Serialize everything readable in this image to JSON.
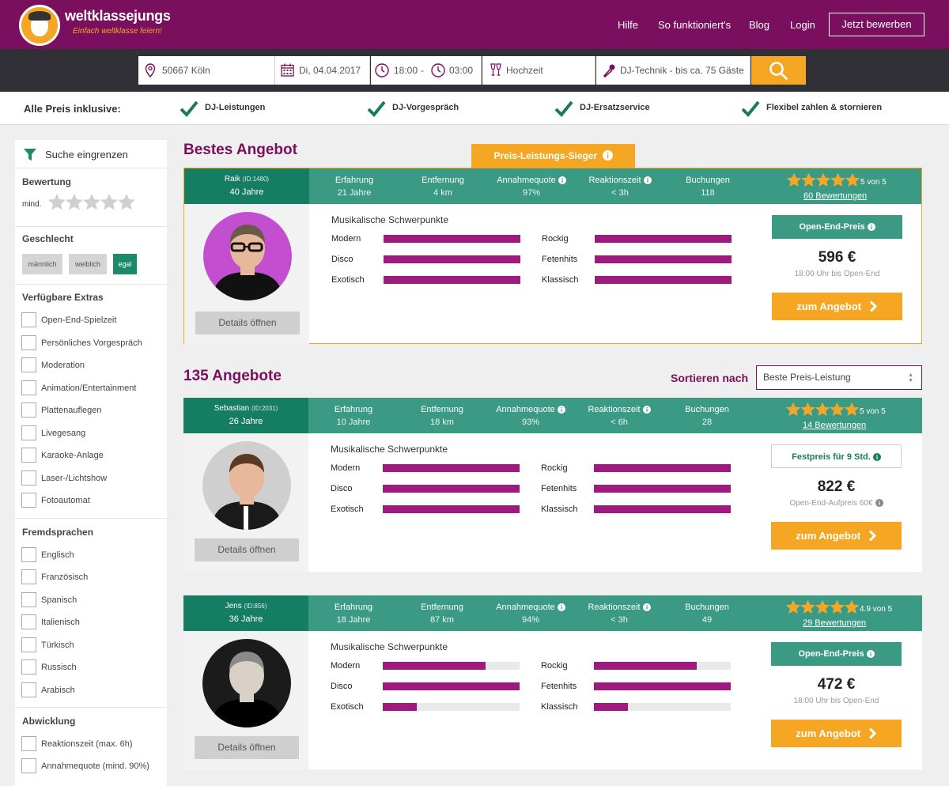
{
  "header": {
    "brand": "weltklassejungs",
    "tagline": "Einfach weltklasse feiern!",
    "nav": [
      "Hilfe",
      "So funktioniert's",
      "Blog",
      "Login"
    ],
    "cta": "Jetzt bewerben"
  },
  "search": {
    "location": "50667 Köln",
    "date": "Di, 04.04.2017",
    "time_from": "18:00",
    "time_sep": "-",
    "time_to": "03:00",
    "event": "Hochzeit",
    "package": "DJ-Technik - bis ca. 75 Gäste"
  },
  "benefits": {
    "label": "Alle Preis inklusive:",
    "items": [
      "DJ-Leistungen",
      "DJ-Vorgespräch",
      "DJ-Ersatzservice",
      "Flexibel zahlen & stornieren"
    ]
  },
  "sidebar": {
    "title": "Suche eingrenzen",
    "rating_title": "Bewertung",
    "rating_min": "mind.",
    "gender_title": "Geschlecht",
    "gender_options": [
      "männlich",
      "weiblich",
      "egal"
    ],
    "extras_title": "Verfügbare Extras",
    "extras": [
      "Open-End-Spielzeit",
      "Persönliches Vorgespräch",
      "Moderation",
      "Animation/Entertainment",
      "Plattenauflegen",
      "Livegesang",
      "Karaoke-Anlage",
      "Laser-/Lichtshow",
      "Fotoautomat"
    ],
    "languages_title": "Fremdsprachen",
    "languages": [
      "Englisch",
      "Französisch",
      "Spanisch",
      "Italienisch",
      "Türkisch",
      "Russisch",
      "Arabisch"
    ],
    "processing_title": "Abwicklung",
    "processing": [
      "Reaktionszeit (max. 6h)",
      "Annahmequote (mind. 90%)"
    ]
  },
  "best": {
    "heading": "Bestes Angebot",
    "winner": "Preis-Leistungs-Sieger"
  },
  "list": {
    "heading": "135 Angebote",
    "sort_label": "Sortieren nach",
    "sort_value": "Beste Preis-Leistung"
  },
  "labels": {
    "experience": "Erfahrung",
    "distance": "Entfernung",
    "acceptance": "Annahmequote",
    "reaction": "Reaktionszeit",
    "bookings": "Buchungen",
    "genres_title": "Musikalische Schwerpunkte",
    "details": "Details öffnen",
    "offer": "zum Angebot"
  },
  "genre_names": [
    "Modern",
    "Rockig",
    "Disco",
    "Fetenhits",
    "Exotisch",
    "Klassisch"
  ],
  "djs": [
    {
      "name": "Raik",
      "id": "(ID:1480)",
      "age": "40 Jahre",
      "experience": "21 Jahre",
      "distance": "4 km",
      "acceptance": "97%",
      "reaction": "< 3h",
      "bookings": "118",
      "rating": 5,
      "score": "5 von 5",
      "reviews": "60 Bewertungen",
      "genres": [
        1,
        1,
        1,
        1,
        1,
        1
      ],
      "price_badge": "Open-End-Preis",
      "price": "596 €",
      "price_sub": "18:00 Uhr bis Open-End",
      "avatar_bg": "#c34fd0",
      "shirt": "#111"
    },
    {
      "name": "Sebastian",
      "id": "(ID:2031)",
      "age": "26 Jahre",
      "experience": "10 Jahre",
      "distance": "18 km",
      "acceptance": "93%",
      "reaction": "< 6h",
      "bookings": "28",
      "rating": 5,
      "score": "5 von 5",
      "reviews": "14 Bewertungen",
      "genres": [
        1,
        1,
        1,
        1,
        1,
        1
      ],
      "price_badge": "Festpreis für 9 Std.",
      "price": "822 €",
      "price_sub": "Open-End-Aufpreis 60€",
      "avatar_bg": "#cfcfcf",
      "shirt": "#1a1a1a"
    },
    {
      "name": "Jens",
      "id": "(ID:856)",
      "age": "36 Jahre",
      "experience": "18 Jahre",
      "distance": "87 km",
      "acceptance": "94%",
      "reaction": "< 3h",
      "bookings": "49",
      "rating": 4.9,
      "score": "4.9 von 5",
      "reviews": "29 Bewertungen",
      "genres": [
        0.75,
        0.75,
        1,
        1,
        0.25,
        0.25
      ],
      "price_badge": "Open-End-Preis",
      "price": "472 €",
      "price_sub": "18:00 Uhr bis Open-End",
      "avatar_bg": "#1b1b1b",
      "shirt": "#000"
    }
  ],
  "colors": {
    "brand_purple": "#7a0f5e",
    "accent_orange": "#f5a623",
    "teal": "#3a9a84",
    "dark_teal": "#147d62",
    "bar_purple": "#a0197e"
  }
}
